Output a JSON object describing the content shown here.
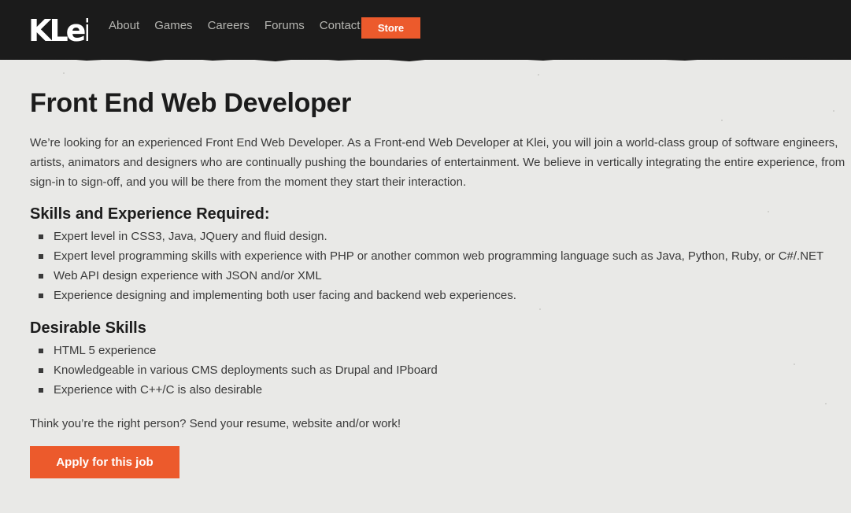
{
  "header": {
    "logo_text": "KLei",
    "nav": [
      {
        "label": "About"
      },
      {
        "label": "Games"
      },
      {
        "label": "Careers"
      },
      {
        "label": "Forums"
      },
      {
        "label": "Contact"
      }
    ],
    "store_label": "Store"
  },
  "job": {
    "title": "Front End Web Developer",
    "intro": "We’re looking for an experienced Front End Web Developer. As a Front-end Web Developer at Klei, you will join a world-class group of software engineers, artists, animators and designers who are continually pushing the boundaries of entertainment. We believe in vertically integrating the entire experience, from sign-in to sign-off, and you will be there from the moment they start their interaction.",
    "required": {
      "heading": "Skills and Experience Required:",
      "items": [
        "Expert level in CSS3, Java, JQuery and fluid design.",
        "Expert level programming skills with experience with PHP or another common web programming language such as Java, Python, Ruby, or C#/.NET",
        "Web API design experience with JSON and/or XML",
        "Experience designing and implementing both user facing and backend web experiences."
      ]
    },
    "desirable": {
      "heading": "Desirable Skills",
      "items": [
        "HTML 5 experience",
        "Knowledgeable in various CMS deployments such as Drupal and IPboard",
        "Experience with C++/C is also desirable"
      ]
    },
    "closing": "Think you’re the right person? Send your resume, website and/or work!",
    "apply_label": "Apply for this job"
  },
  "colors": {
    "accent": "#ec5a2c",
    "nav_bg": "#1b1b1b",
    "page_bg": "#e9e9e7"
  }
}
